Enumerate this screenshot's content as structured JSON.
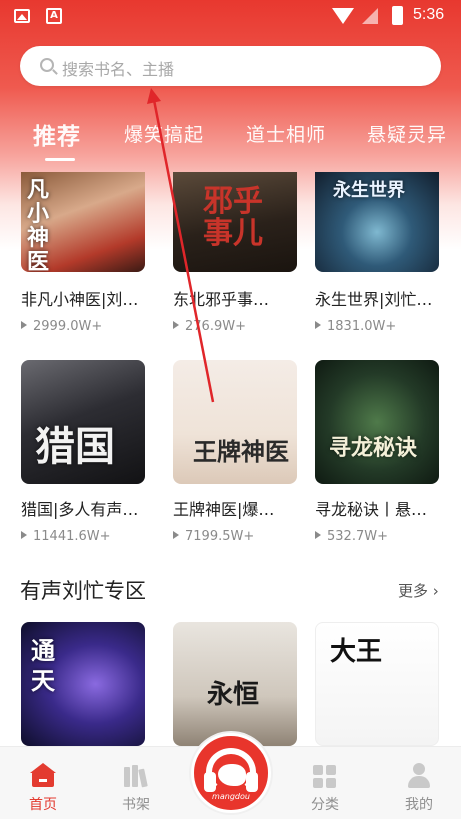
{
  "status_bar": {
    "time": "5:36",
    "icons": [
      "image-icon",
      "a-icon",
      "wifi-icon",
      "signal-icon",
      "battery-icon"
    ]
  },
  "search": {
    "placeholder": "搜索书名、主播"
  },
  "tabs": [
    {
      "label": "推荐",
      "active": true
    },
    {
      "label": "爆笑搞起",
      "active": false
    },
    {
      "label": "道士相师",
      "active": false
    },
    {
      "label": "悬疑灵异",
      "active": false
    }
  ],
  "recommend_rows": [
    [
      {
        "title": "非凡小神医|刘…",
        "plays": "2999.0W+",
        "cover_text": "凡小神医"
      },
      {
        "title": "东北邪乎事…",
        "plays": "276.9W+",
        "cover_text": "邪乎事儿"
      },
      {
        "title": "永生世界|刘忙…",
        "plays": "1831.0W+",
        "cover_text": "永生世界"
      }
    ],
    [
      {
        "title": "猎国|多人有声…",
        "plays": "11441.6W+",
        "cover_text": "猎国"
      },
      {
        "title": "王牌神医|爆…",
        "plays": "7199.5W+",
        "cover_text": "王牌神医"
      },
      {
        "title": "寻龙秘诀丨悬…",
        "plays": "532.7W+",
        "cover_text": "寻龙秘诀"
      }
    ]
  ],
  "section": {
    "title": "有声刘忙专区",
    "more": "更多"
  },
  "section_books": [
    {
      "cover_text": "通天"
    },
    {
      "cover_text": "永恒"
    },
    {
      "cover_text": "大王"
    }
  ],
  "bottom_nav": {
    "home": "首页",
    "shelf": "书架",
    "center_logo_text": "mangdou",
    "category": "分类",
    "mine": "我的"
  },
  "colors": {
    "brand_red": "#e33b30",
    "header_top": "#e8382f",
    "annotation_arrow": "#e0262a"
  }
}
